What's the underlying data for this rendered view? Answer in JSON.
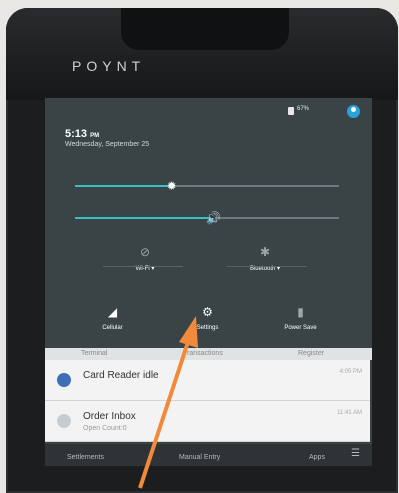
{
  "device": {
    "brand": "POYNT"
  },
  "status": {
    "battery": "67%"
  },
  "clock": {
    "time": "5:13",
    "ampm": "PM",
    "date": "Wednesday, September 25"
  },
  "brightness": {
    "level": 0.37
  },
  "volume": {
    "level": 0.52
  },
  "tiles": {
    "wifi": "Wi-Fi ▾",
    "bluetooth": "Bluetooth ▾",
    "cellular": "Cellular",
    "settings": "Settings",
    "power": "Power Save"
  },
  "underlay": {
    "left": "Terminal",
    "middle": "Transactions",
    "right": "Register"
  },
  "notifications": [
    {
      "title": "Card Reader idle",
      "sub": "",
      "time": "4:05 PM"
    },
    {
      "title": "Order Inbox",
      "sub": "Open Count:0",
      "time": "11:41 AM"
    }
  ],
  "bottom": {
    "left": "Settlements",
    "middle": "Manual Entry",
    "right": "Apps"
  },
  "colors": {
    "accent": "#36c0c9",
    "arrow": "#f28a3c",
    "avatar": "#27a3d9"
  }
}
